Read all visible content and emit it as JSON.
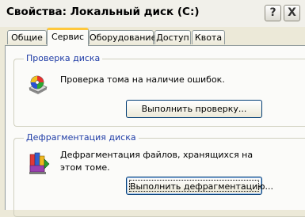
{
  "window": {
    "title": "Свойства: Локальный диск (C:)",
    "help_label": "?",
    "close_label": "X"
  },
  "tabs": [
    {
      "label": "Общие",
      "active": false
    },
    {
      "label": "Сервис",
      "active": true
    },
    {
      "label": "Оборудование",
      "active": false
    },
    {
      "label": "Доступ",
      "active": false
    },
    {
      "label": "Квота",
      "active": false
    }
  ],
  "check_disk": {
    "group_label": "Проверка диска",
    "description": "Проверка тома на наличие ошибок.",
    "button_label": "Выполнить проверку..."
  },
  "defrag": {
    "group_label": "Дефрагментация диска",
    "description": "Дефрагментация файлов, хранящихся на этом томе.",
    "button_label": "Выполнить дефрагментацию..."
  },
  "icons": {
    "check_disk": "disk-check-icon",
    "defrag": "defrag-icon"
  }
}
